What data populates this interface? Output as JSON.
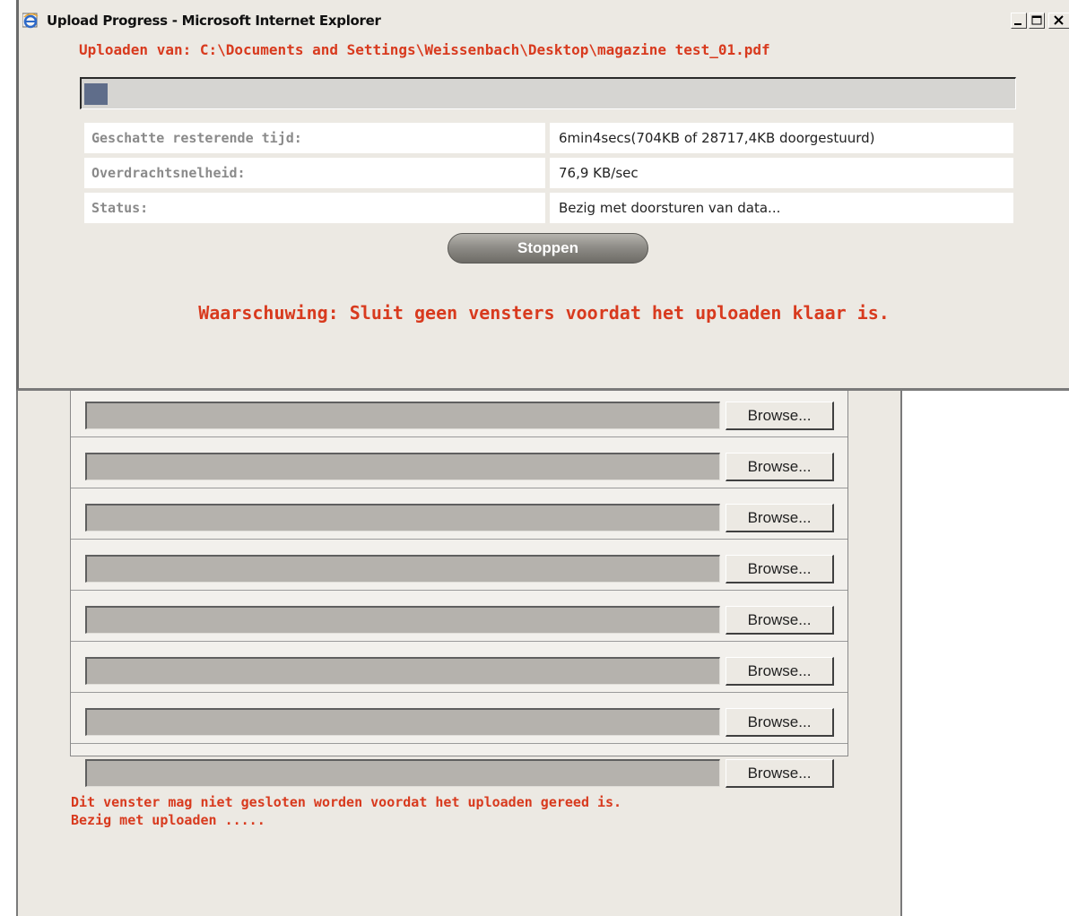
{
  "popup": {
    "title": "Upload Progress - Microsoft Internet Explorer",
    "upload_path": "Uploaden van: C:\\Documents and Settings\\Weissenbach\\Desktop\\magazine test_01.pdf",
    "progress_fraction": 0.025,
    "info_rows": [
      {
        "label": "Geschatte resterende tijd:",
        "value": "6min4secs(704KB of 28717,4KB doorgestuurd)"
      },
      {
        "label": "Overdrachtsnelheid:",
        "value": "76,9 KB/sec"
      },
      {
        "label": "Status:",
        "value": "Bezig met doorsturen van data..."
      }
    ],
    "stop_label": "Stoppen",
    "warning": "Waarschuwing: Sluit geen vensters voordat het uploaden klaar is.",
    "icons": {
      "app": "internet-explorer-icon",
      "minimize": "minimize-icon",
      "maximize": "maximize-icon",
      "close": "close-icon"
    }
  },
  "background": {
    "browse_label": "Browse...",
    "warning_lines": [
      "Dit venster mag niet gesloten worden voordat het uploaden gereed is.",
      "Bezig met uploaden ....."
    ]
  },
  "colors": {
    "warning": "#d83a1e",
    "progress": "#5f6d8a",
    "window": "#ece9e3"
  }
}
